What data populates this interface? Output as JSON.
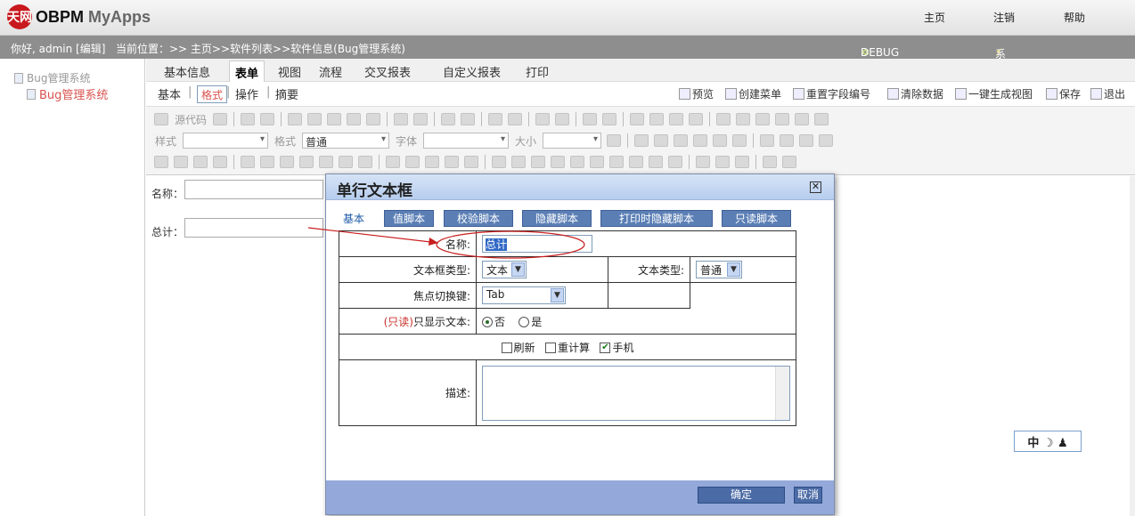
{
  "header": {
    "logo_mark": "天网",
    "brand_obpm": "OBPM",
    "brand_myapps": "MyApps",
    "links": [
      "主页",
      "注销",
      "帮助"
    ]
  },
  "infobar": {
    "greeting": "你好, admin [编辑]",
    "location": "当前位置：>> 主页>>软件列表>>软件信息(Bug管理系统)",
    "debug": "DEBUG",
    "monitor": "系统监控"
  },
  "sidebar": {
    "root": "Bug管理系统",
    "child": "Bug管理系统"
  },
  "tabs": [
    "基本信息",
    "表单",
    "视图",
    "流程",
    "交叉报表",
    "自定义报表",
    "打印"
  ],
  "subtabs": [
    "基本",
    "格式",
    "操作",
    "摘要"
  ],
  "actions": [
    "预览",
    "创建菜单",
    "重置字段编号",
    "清除数据",
    "一键生成视图",
    "保存",
    "退出"
  ],
  "editor": {
    "source": "源代码",
    "style_label": "样式",
    "format_label": "格式",
    "format_value": "普通",
    "font_label": "字体",
    "size_label": "大小"
  },
  "form": {
    "name_label": "名称：",
    "total_label": "总计："
  },
  "ime": "中 ☽ ♟",
  "dialog": {
    "title": "单行文本框",
    "close": "✕",
    "tab_base": "基本",
    "tabs": [
      "值脚本",
      "校验脚本",
      "隐藏脚本",
      "打印时隐藏脚本",
      "只读脚本"
    ],
    "name_label": "名称:",
    "name_value": "总计",
    "box_type_label": "文本框类型:",
    "box_type_value": "文本",
    "text_type_label": "文本类型:",
    "text_type_value": "普通",
    "focus_label": "焦点切换键:",
    "focus_value": "Tab",
    "readonly_prefix": "(只读)",
    "readonly_label": "只显示文本:",
    "radio_no": "否",
    "radio_yes": "是",
    "cb_refresh": "刷新",
    "cb_recalc": "重计算",
    "cb_mobile": "手机",
    "desc_label": "描述:",
    "ok": "确定",
    "cancel": "取消"
  }
}
